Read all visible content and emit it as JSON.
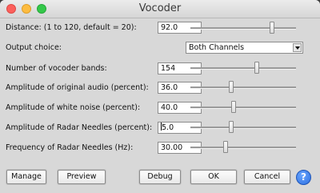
{
  "window": {
    "title": "Vocoder"
  },
  "rows": [
    {
      "label": "Distance: (1 to 120, default = 20):",
      "value": "92.0",
      "slider": 0.77
    },
    {
      "label": "Number of vocoder bands:",
      "value": "154",
      "slider": 0.63
    },
    {
      "label": "Amplitude of original audio (percent):",
      "value": "36.0",
      "slider": 0.39
    },
    {
      "label": "Amplitude of white noise (percent):",
      "value": "40.0",
      "slider": 0.41
    },
    {
      "label": "Amplitude of Radar Needles (percent):",
      "value_suffix": "5.0",
      "slider": 0.39
    },
    {
      "label": "Frequency of Radar Needles (Hz):",
      "value": "30.00",
      "slider": 0.33
    }
  ],
  "output_choice": {
    "label": "Output choice:",
    "selected": "Both Channels"
  },
  "buttons": {
    "manage": "Manage",
    "preview": "Preview",
    "debug": "Debug",
    "ok": "OK",
    "cancel": "Cancel",
    "help": "?"
  }
}
